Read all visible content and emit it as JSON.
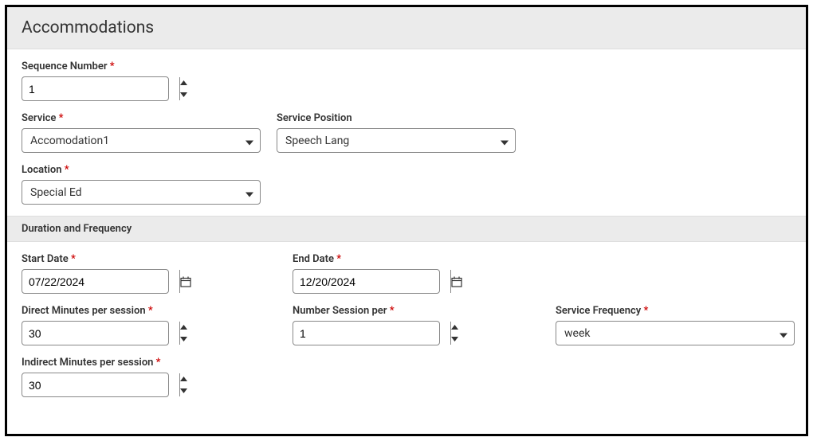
{
  "header": {
    "title": "Accommodations"
  },
  "labels": {
    "sequenceNumber": "Sequence Number",
    "service": "Service",
    "servicePosition": "Service Position",
    "location": "Location",
    "startDate": "Start Date",
    "endDate": "End Date",
    "directMinutes": "Direct Minutes per session",
    "numberSession": "Number Session per",
    "serviceFrequency": "Service Frequency",
    "indirectMinutes": "Indirect Minutes per session"
  },
  "values": {
    "sequenceNumber": "1",
    "service": "Accomodation1",
    "servicePosition": "Speech Lang",
    "location": "Special Ed",
    "startDate": "07/22/2024",
    "endDate": "12/20/2024",
    "directMinutes": "30",
    "numberSession": "1",
    "serviceFrequency": "week",
    "indirectMinutes": "30"
  },
  "sections": {
    "durationFrequency": "Duration and Frequency"
  },
  "requiredMark": "*"
}
